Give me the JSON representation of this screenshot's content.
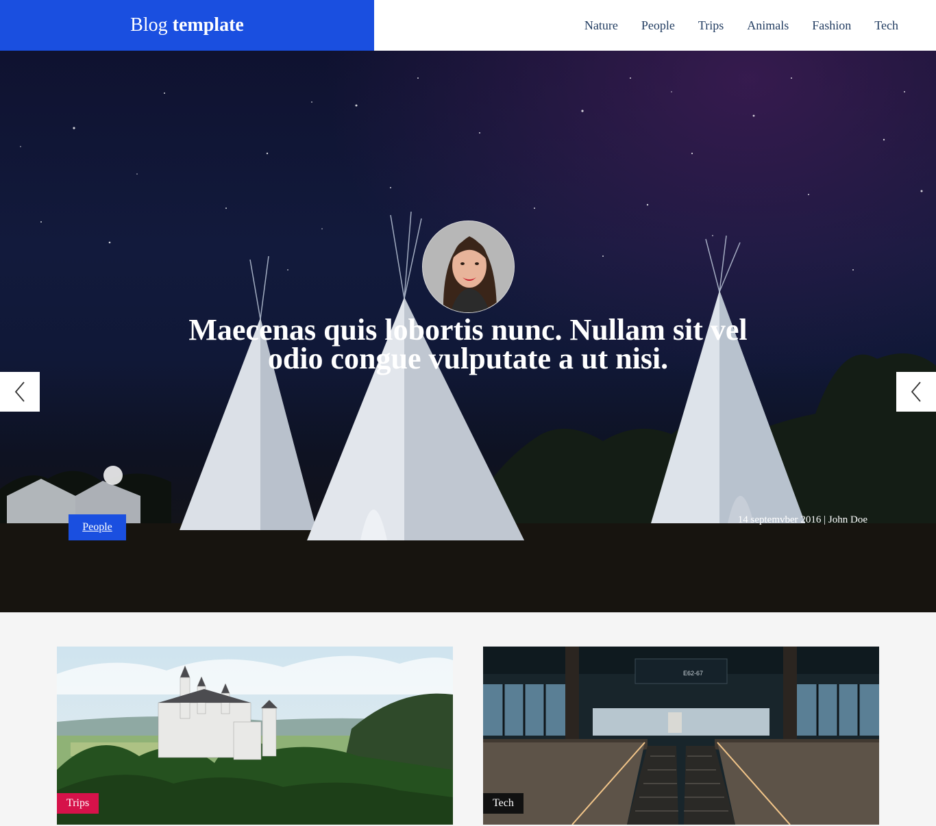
{
  "header": {
    "brand_regular": "Blog",
    "brand_bold": "template",
    "brand_color": "#1a4fe0",
    "nav": [
      "Nature",
      "People",
      "Trips",
      "Animals",
      "Fashion",
      "Tech"
    ]
  },
  "hero": {
    "title": "Maecenas quis lobortis nunc. Nullam sit vel odio congue vulputate a ut nisi.",
    "tag": "People",
    "meta": "14 septemvber 2016 | John Doe",
    "prev_icon": "chevron-left-icon",
    "next_icon": "chevron-left-icon"
  },
  "cards": [
    {
      "tag": "Trips",
      "tag_color": "#d6124a",
      "image": "castle-landscape"
    },
    {
      "tag": "Tech",
      "tag_color": "#111111",
      "image": "station-escalators"
    }
  ]
}
